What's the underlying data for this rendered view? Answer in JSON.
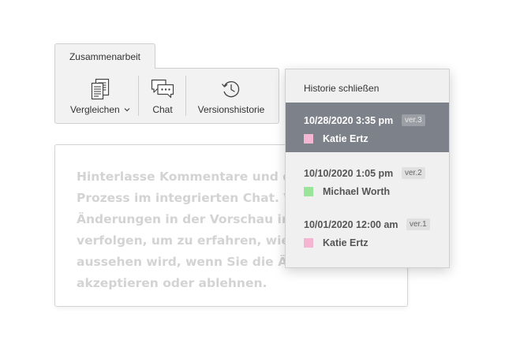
{
  "ribbon": {
    "tab_label": "Zusammenarbeit",
    "compare_label": "Vergleichen",
    "chat_label": "Chat",
    "history_label": "Versionshistorie"
  },
  "document": {
    "text": "Hinterlasse Kommentare und dis\nProzess im integrierten Chat. Ver\nÄnderungen in der Vorschau in de\nverfolgen, um zu erfahren, wie Ih\naussehen wird, wenn Sie die Ände\nakzeptieren oder ablehnen."
  },
  "history": {
    "close_label": "Historie schließen",
    "selected_index": 0,
    "entries": [
      {
        "date": "10/28/2020 3:35 pm",
        "version": "ver.3",
        "author": "Katie Ertz",
        "color": "#f4b6d2"
      },
      {
        "date": "10/10/2020 1:05 pm",
        "version": "ver.2",
        "author": "Michael Worth",
        "color": "#9ae59a"
      },
      {
        "date": "10/01/2020 12:00 am",
        "version": "ver.1",
        "author": "Katie Ertz",
        "color": "#f4b6d2"
      }
    ]
  }
}
